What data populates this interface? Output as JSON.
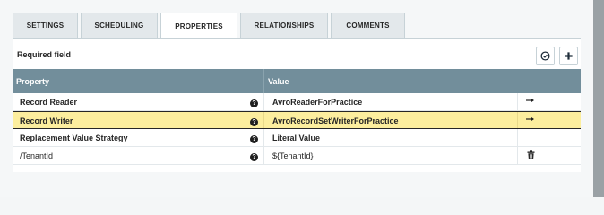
{
  "tabs": [
    {
      "label": "SETTINGS"
    },
    {
      "label": "SCHEDULING"
    },
    {
      "label": "PROPERTIES"
    },
    {
      "label": "RELATIONSHIPS"
    },
    {
      "label": "COMMENTS"
    }
  ],
  "active_tab": "PROPERTIES",
  "required_field_label": "Required field",
  "table": {
    "headers": {
      "property": "Property",
      "value": "Value"
    },
    "rows": [
      {
        "name": "Record Reader",
        "value": "AvroReaderForPractice",
        "action_icon": "arrow-right-icon"
      },
      {
        "name": "Record Writer",
        "value": "AvroRecordSetWriterForPractice",
        "action_icon": "arrow-right-icon"
      },
      {
        "name": "Replacement Value Strategy",
        "value": "Literal Value",
        "action_icon": ""
      },
      {
        "name": "/TenantId",
        "value": "${TenantId}",
        "action_icon": "trash-icon"
      }
    ]
  },
  "colors": {
    "header_bg": "#728e9b",
    "highlight_row": "#fcee9e"
  }
}
